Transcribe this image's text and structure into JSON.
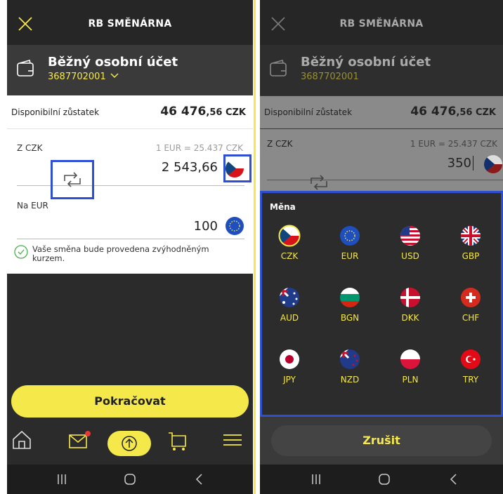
{
  "app": {
    "title": "RB SMĚNÁRNA"
  },
  "account": {
    "name": "Běžný osobní účet",
    "number": "3687702001"
  },
  "balance": {
    "label": "Disponibilní zůstatek",
    "amount_main": "46 476",
    "amount_decimals": ",56 CZK"
  },
  "exchange": {
    "from_label": "Z CZK",
    "rate": "1 EUR = 25.437 CZK",
    "from_amount": "2 543,66",
    "to_label": "Na EUR",
    "to_amount": "100",
    "note": "Vaše směna bude provedena zvýhodněným kurzem."
  },
  "continue_label": "Pokračovat",
  "right": {
    "from_amount": "350",
    "picker_title": "Měna",
    "currencies": [
      "CZK",
      "EUR",
      "USD",
      "GBP",
      "AUD",
      "BGN",
      "DKK",
      "CHF",
      "JPY",
      "NZD",
      "PLN",
      "TRY"
    ],
    "cancel_label": "Zrušit"
  },
  "colors": {
    "accent": "#f5e84a",
    "highlight": "#2e4fd1",
    "dark": "#2b2b2b"
  },
  "icons": [
    "close-icon",
    "wallet-icon",
    "chevron-down-icon",
    "swap-icon",
    "check-circle-icon",
    "home-icon",
    "mail-icon",
    "transfer-icon",
    "cart-icon",
    "menu-icon"
  ]
}
